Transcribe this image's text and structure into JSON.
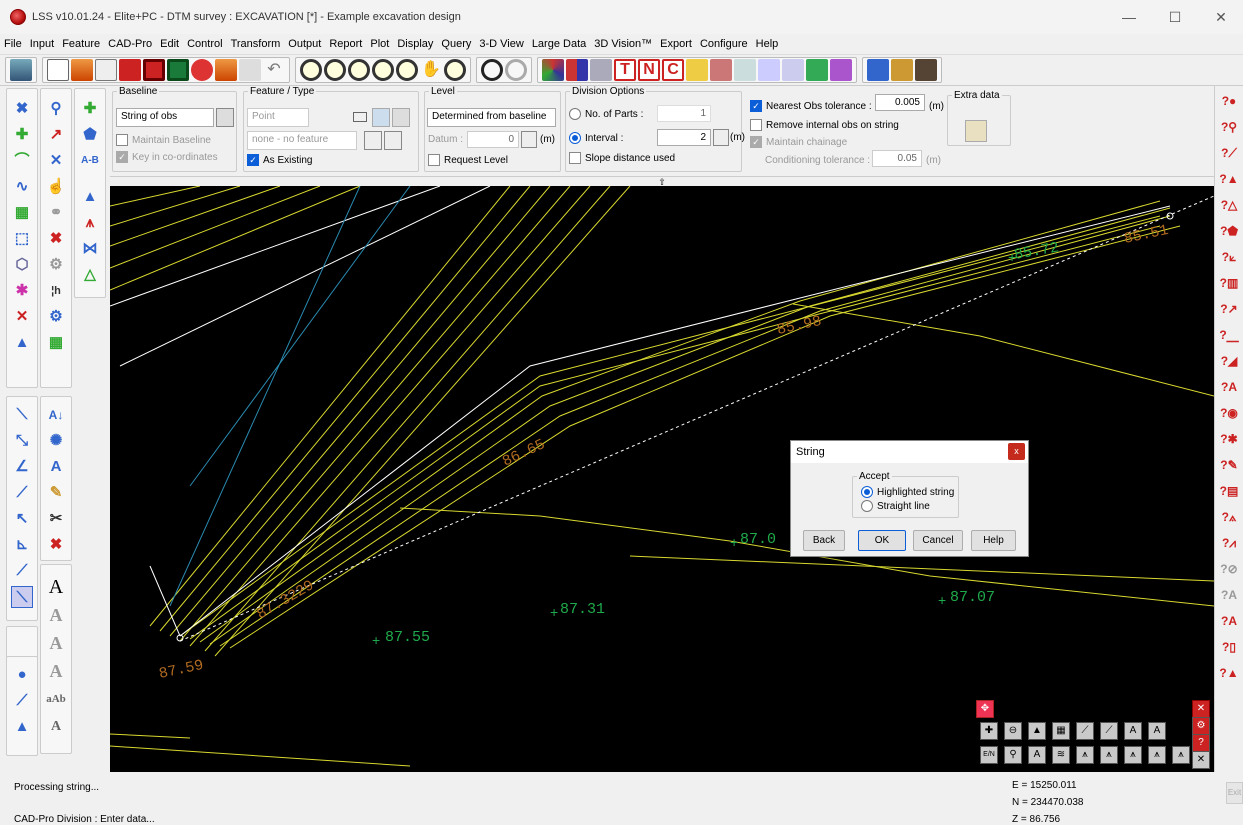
{
  "window": {
    "title": "LSS v10.01.24 - Elite+PC - DTM survey : EXCAVATION [*] - Example excavation design",
    "minimize": "—",
    "maximize": "☐",
    "close": "✕"
  },
  "menu": [
    "File",
    "Input",
    "Feature",
    "CAD-Pro",
    "Edit",
    "Control",
    "Transform",
    "Output",
    "Report",
    "Plot",
    "Display",
    "Query",
    "3-D View",
    "Large Data",
    "3D Vision™",
    "Export",
    "Configure",
    "Help"
  ],
  "ribbon": {
    "baseline": {
      "legend": "Baseline",
      "select": "String of obs",
      "maintain": "Maintain Baseline",
      "key_coords": "Key in co-ordinates"
    },
    "feature": {
      "legend": "Feature / Type",
      "type": "Point",
      "feature": "none - no feature",
      "as_existing": "As Existing"
    },
    "level": {
      "legend": "Level",
      "select": "Determined from baseline",
      "datum_label": "Datum :",
      "datum_value": "0",
      "unit": "(m)",
      "request": "Request Level"
    },
    "division": {
      "legend": "Division Options",
      "parts_label": "No. of Parts :",
      "parts_value": "1",
      "interval_label": "Interval :",
      "interval_value": "2",
      "unit": "(m)",
      "slope": "Slope distance used"
    },
    "tolerance": {
      "nearest": "Nearest Obs tolerance :",
      "nearest_value": "0.005",
      "unit": "(m)",
      "remove": "Remove internal obs on string",
      "maintain": "Maintain chainage",
      "cond_label": "Conditioning tolerance :",
      "cond_value": "0.05",
      "cond_unit": "(m)"
    },
    "extra": {
      "legend": "Extra data"
    },
    "collapse": "⇧"
  },
  "canvas": {
    "labels_orange": [
      "85.51",
      "85.98",
      "86.65",
      "87.59"
    ],
    "labels_green": [
      "85.72",
      "87.0",
      "87.31",
      "87.55",
      "87.07"
    ],
    "label_overlap": "87.3229"
  },
  "dialog": {
    "title": "String",
    "close": "x",
    "group": "Accept",
    "opt1": "Highlighted string",
    "opt2": "Straight line",
    "back": "Back",
    "ok": "OK",
    "cancel": "Cancel",
    "help": "Help"
  },
  "left_text_icons": [
    "A",
    "A",
    "A",
    "A",
    "aAb",
    "A"
  ],
  "status": {
    "line1": "Processing string...",
    "line2": "CAD-Pro Division : Enter data...",
    "e": "E = 15250.011",
    "n": "N = 234470.038",
    "z": "Z = 86.756",
    "exit": "Exit"
  }
}
